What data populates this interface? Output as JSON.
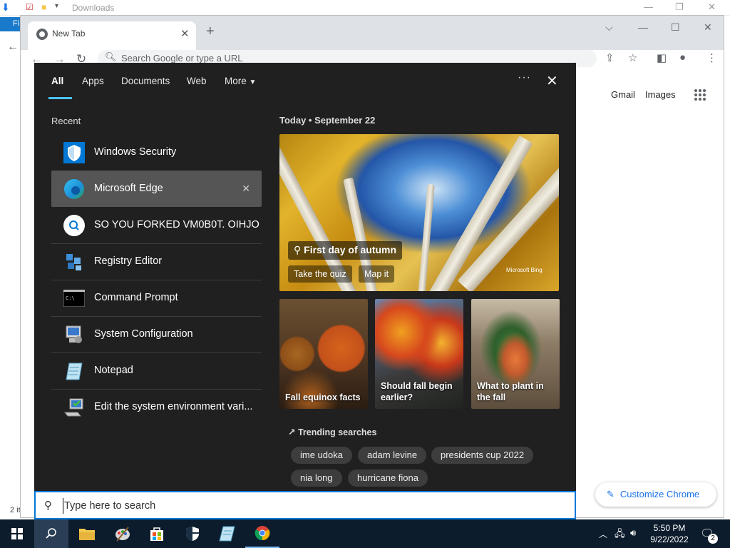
{
  "explorer": {
    "title": "Downloads",
    "ribbon_tab": "Fi",
    "item_count": "2 it"
  },
  "chrome": {
    "tab_title": "New Tab",
    "omnibox_placeholder": "Search Google or type a URL",
    "gmail": "Gmail",
    "images": "Images",
    "customize": "Customize Chrome"
  },
  "search_panel": {
    "tabs": [
      "All",
      "Apps",
      "Documents",
      "Web",
      "More"
    ],
    "recent_heading": "Recent",
    "recent_items": [
      {
        "label": "Windows Security",
        "icon": "shield-icon"
      },
      {
        "label": "Microsoft Edge",
        "icon": "edge-icon",
        "selected": true
      },
      {
        "label": "SO YOU FORKED VM0B0T. OIHJO...",
        "icon": "search-icon"
      },
      {
        "label": "Registry Editor",
        "icon": "registry-icon"
      },
      {
        "label": "Command Prompt",
        "icon": "cmd-icon"
      },
      {
        "label": "System Configuration",
        "icon": "msconfig-icon"
      },
      {
        "label": "Notepad",
        "icon": "notepad-icon"
      },
      {
        "label": "Edit the system environment vari...",
        "icon": "system-properties-icon"
      }
    ],
    "today_label": "Today  •  September 22",
    "hero": {
      "caption": "First day of autumn",
      "buttons": [
        "Take the quiz",
        "Map it"
      ],
      "brand": "Microsoft Bing"
    },
    "cards": [
      {
        "caption": "Fall equinox facts"
      },
      {
        "caption": "Should fall begin earlier?"
      },
      {
        "caption": "What to plant in the fall"
      }
    ],
    "trending_heading": "Trending searches",
    "trending": [
      "ime udoka",
      "adam levine",
      "presidents cup 2022",
      "nia long",
      "hurricane fiona"
    ]
  },
  "searchbar": {
    "placeholder": "Type here to search"
  },
  "taskbar": {
    "time": "5:50 PM",
    "date": "9/22/2022",
    "notification_count": "2"
  }
}
